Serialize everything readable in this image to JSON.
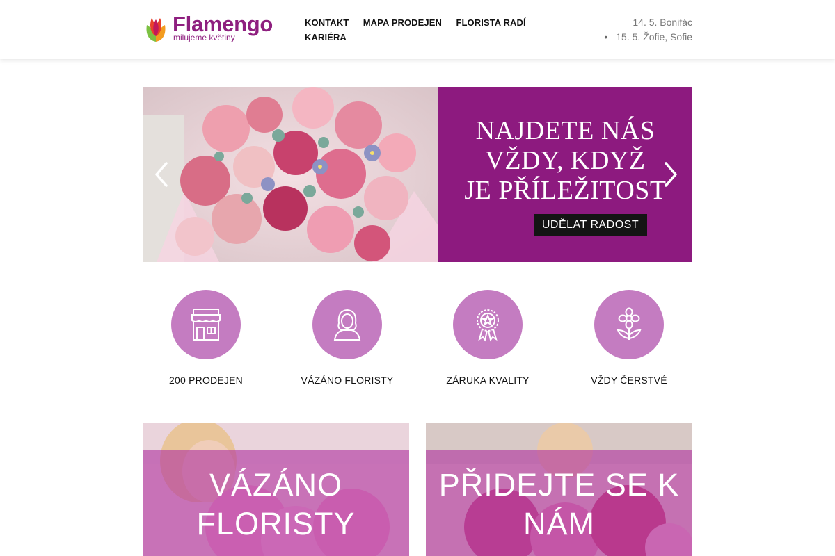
{
  "brand": {
    "name": "Flamengo",
    "tagline": "milujeme květiny",
    "colors": {
      "primary": "#8e1f7f",
      "feature_circle": "#c47cc1",
      "cta": "#141414"
    }
  },
  "nav": {
    "items": [
      {
        "label": "KONTAKT"
      },
      {
        "label": "MAPA PRODEJEN"
      },
      {
        "label": "FLORISTA RADÍ"
      },
      {
        "label": "KARIÉRA"
      }
    ]
  },
  "namedays": {
    "today": "14. 5. Bonifác",
    "bullet": "•",
    "tomorrow": "15. 5. Žofie, Sofie"
  },
  "slider": {
    "headline_line1": "NAJDETE NÁS",
    "headline_line2": "VŽDY, KDYŽ",
    "headline_line3": "JE PŘÍLEŽITOST",
    "cta_label": "UDĚLAT RADOST",
    "prev_icon": "chevron-left-icon",
    "next_icon": "chevron-right-icon"
  },
  "features": [
    {
      "label": "200 PRODEJEN",
      "icon": "storefront-icon"
    },
    {
      "label": "VÁZÁNO FLORISTY",
      "icon": "florist-person-icon"
    },
    {
      "label": "ZÁRUKA KVALITY",
      "icon": "quality-rosette-icon"
    },
    {
      "label": "VŽDY ČERSTVÉ",
      "icon": "flower-icon"
    }
  ],
  "cards": [
    {
      "title_line1": "VÁZÁNO",
      "title_line2": "FLORISTY"
    },
    {
      "title_line1": "PŘIDEJTE SE K",
      "title_line2": "NÁM"
    }
  ]
}
